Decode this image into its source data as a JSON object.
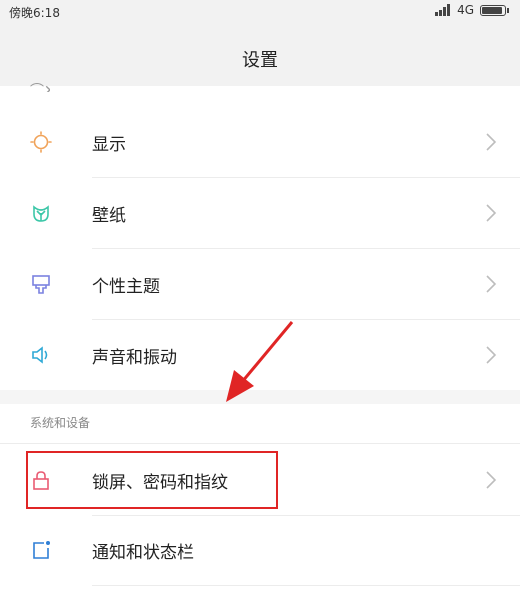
{
  "status_bar": {
    "time": "傍晚6:18",
    "network": "4G",
    "icons": [
      "signal-icon",
      "battery-icon"
    ]
  },
  "header": {
    "title": "设置"
  },
  "items": [
    {
      "label": "显示",
      "icon": "sun-icon"
    },
    {
      "label": "壁纸",
      "icon": "wallpaper-icon"
    },
    {
      "label": "个性主题",
      "icon": "theme-icon"
    },
    {
      "label": "声音和振动",
      "icon": "speaker-icon"
    }
  ],
  "section": {
    "header": "系统和设备",
    "items": [
      {
        "label": "锁屏、密码和指纹",
        "icon": "lock-icon"
      },
      {
        "label": "通知和状态栏",
        "icon": "notification-icon"
      }
    ]
  },
  "colors": {
    "highlight": "#e02525",
    "sun": "#f0a35a",
    "wallpaper": "#3cc7a8",
    "theme": "#7b82e0",
    "speaker": "#2fa9d6",
    "lock": "#e95b73",
    "notification": "#2f7fd6"
  }
}
